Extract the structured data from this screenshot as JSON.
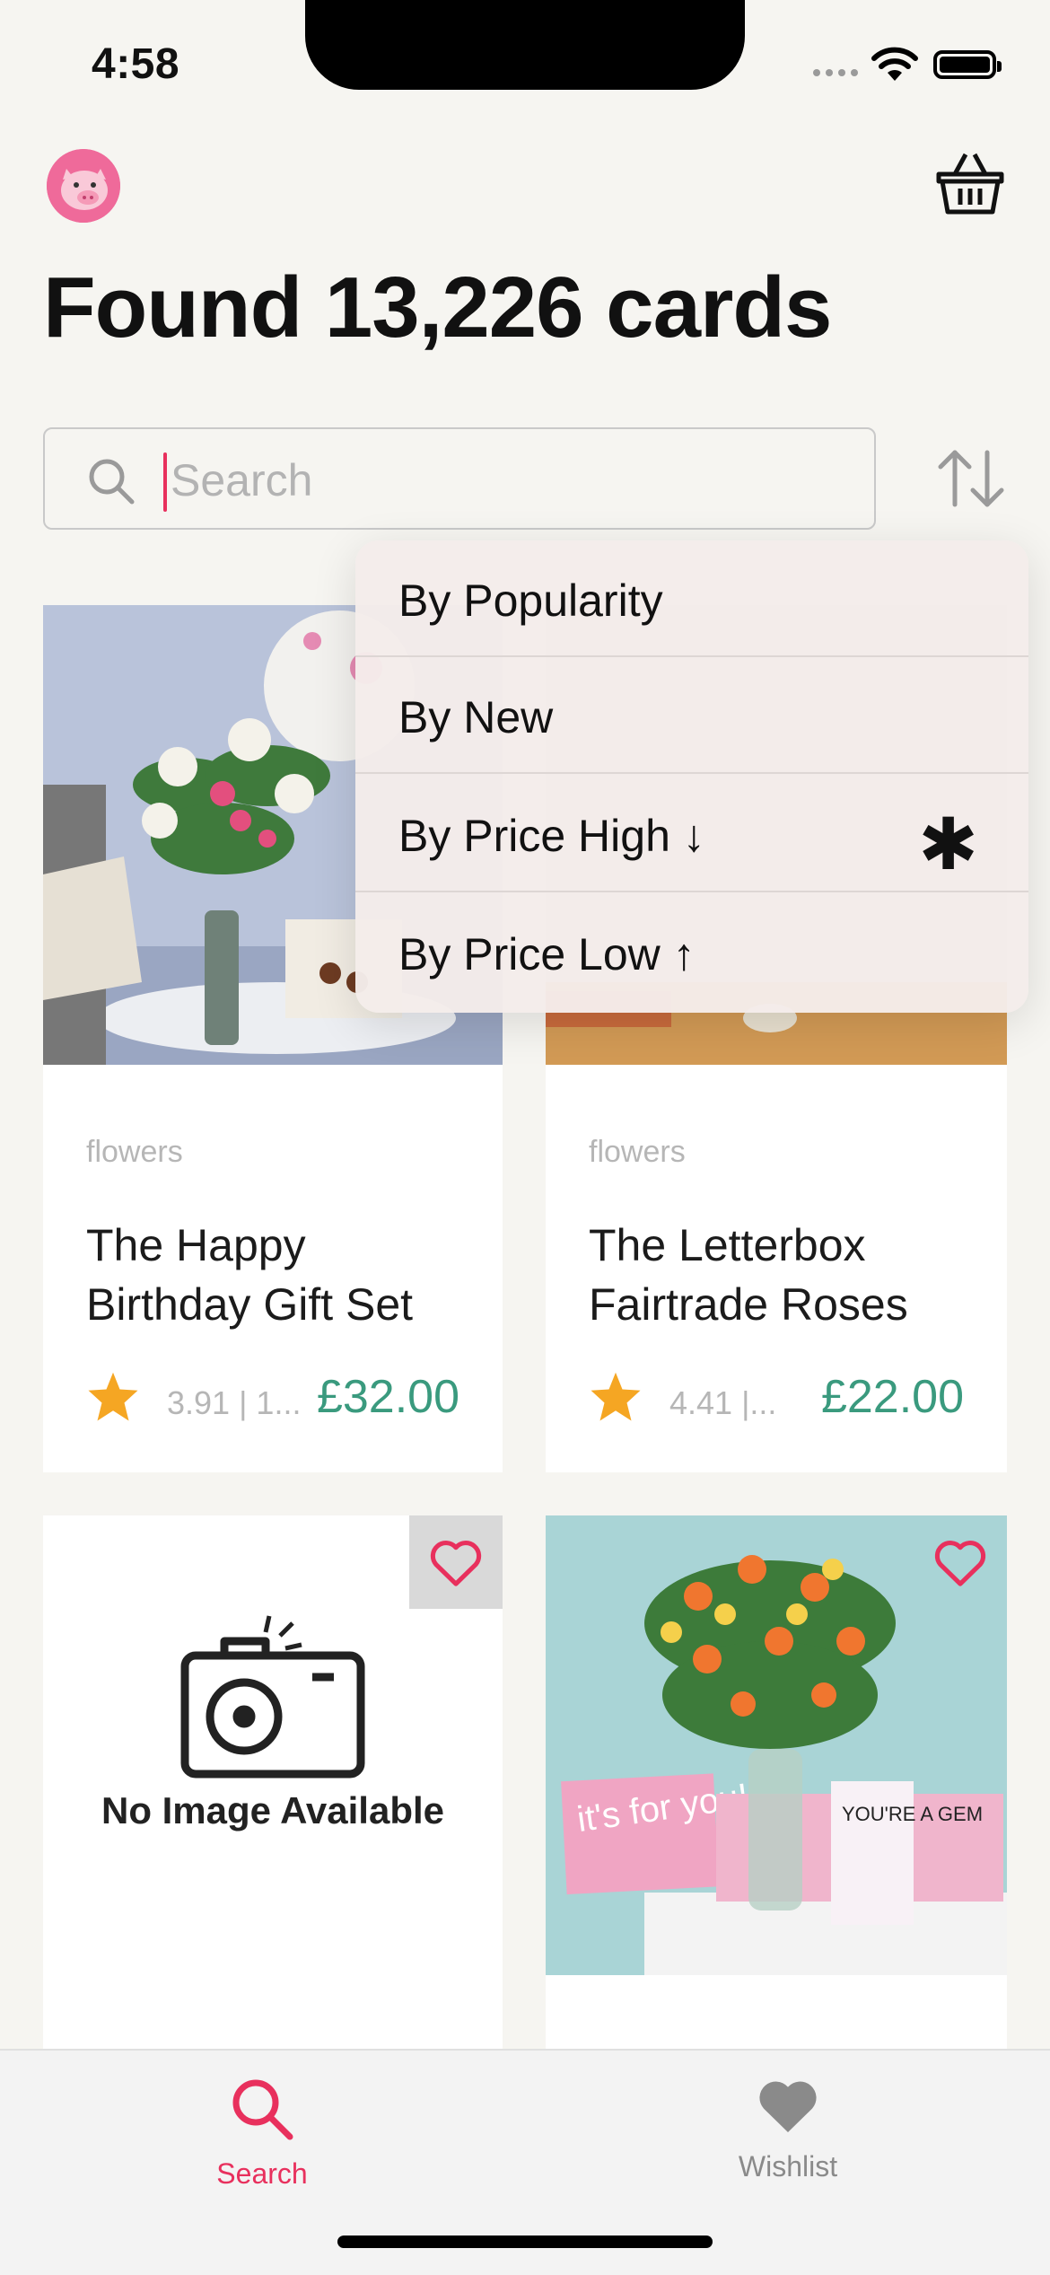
{
  "status_bar": {
    "time": "4:58"
  },
  "header": {
    "title": "Found 13,226 cards"
  },
  "search": {
    "placeholder": "Search"
  },
  "sort_menu": {
    "options": [
      {
        "label": "By Popularity"
      },
      {
        "label": "By New"
      },
      {
        "label": "By Price High ↓",
        "selected": true,
        "mark": "✱"
      },
      {
        "label": "By Price Low ↑"
      }
    ]
  },
  "products": [
    {
      "category": "flowers",
      "name": "The Happy Birthday Gift Set",
      "rating": "3.91 | 1...",
      "price": "£32.00",
      "image": "photo"
    },
    {
      "category": "flowers",
      "name": "The Letterbox Fairtrade Roses",
      "rating": "4.41 |...",
      "price": "£22.00",
      "image": "photo"
    },
    {
      "image": "placeholder",
      "no_image_text": "No Image Available"
    },
    {
      "image": "photo",
      "card_text": [
        "it's for you!",
        "YOU'RE A GEM"
      ]
    }
  ],
  "tab_bar": {
    "tabs": [
      {
        "label": "Search",
        "active": true,
        "icon": "search-icon"
      },
      {
        "label": "Wishlist",
        "active": false,
        "icon": "heart-icon"
      }
    ]
  },
  "colors": {
    "accent": "#e8305d",
    "price": "#3a9a7e",
    "star": "#f5a623"
  }
}
